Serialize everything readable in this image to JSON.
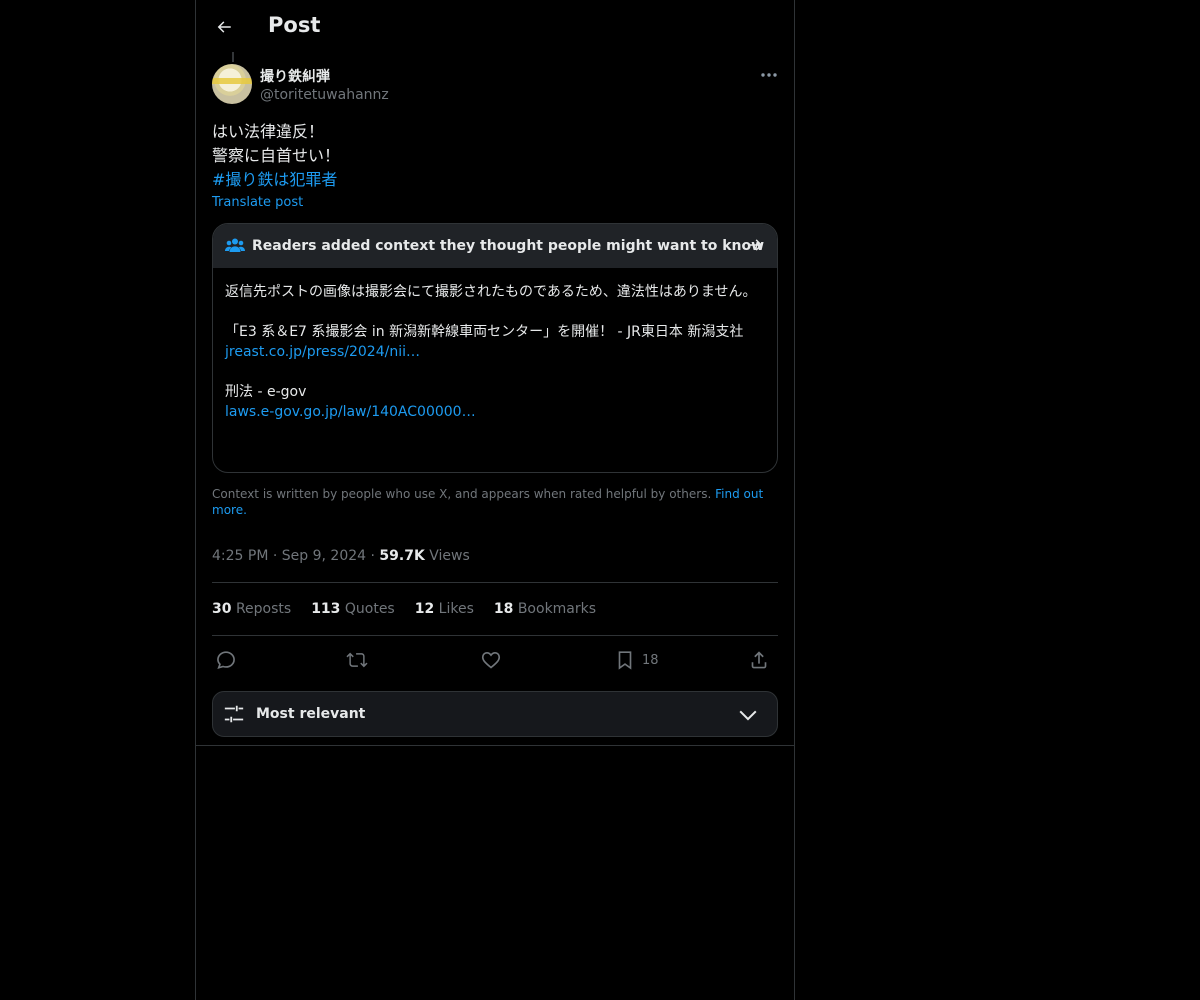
{
  "header": {
    "title": "Post",
    "back_icon": "arrow-left-icon"
  },
  "author": {
    "name": "撮り鉄糾弾",
    "handle": "@toritetuwahannz"
  },
  "post": {
    "lines": [
      "はい法律違反！",
      "警察に自首せい！"
    ],
    "hashtag": "#撮り鉄は犯罪者",
    "translate_label": "Translate post"
  },
  "community_note": {
    "title": "Readers added context they thought people might want to know",
    "paragraph1": "返信先ポストの画像は撮影会にて撮影されたものであるため、違法性はありません。",
    "source1_title": "「E3 系＆E7 系撮影会 in 新潟新幹線車両センター」を開催！ - JR東日本 新潟支社",
    "source1_link": "jreast.co.jp/press/2024/nii…",
    "source2_title": "刑法 - e-gov",
    "source2_link": "laws.e-gov.go.jp/law/140AC00000…"
  },
  "context_disclaimer": {
    "text": "Context is written by people who use X, and appears when rated helpful by others.",
    "link": "Find out more."
  },
  "meta": {
    "time": "4:25 PM",
    "date": "Sep 9, 2024",
    "views_count": "59.7K",
    "views_label": "Views",
    "separator": "·"
  },
  "stats": {
    "reposts_count": "30",
    "reposts_label": "Reposts",
    "quotes_count": "113",
    "quotes_label": "Quotes",
    "likes_count": "12",
    "likes_label": "Likes",
    "bookmarks_count": "18",
    "bookmarks_label": "Bookmarks"
  },
  "actions": {
    "bookmark_count": "18"
  },
  "sort": {
    "label": "Most relevant"
  },
  "colors": {
    "background": "#000000",
    "accent": "#1d9bf0",
    "secondary_text": "#71767b",
    "border": "#2f3336"
  }
}
